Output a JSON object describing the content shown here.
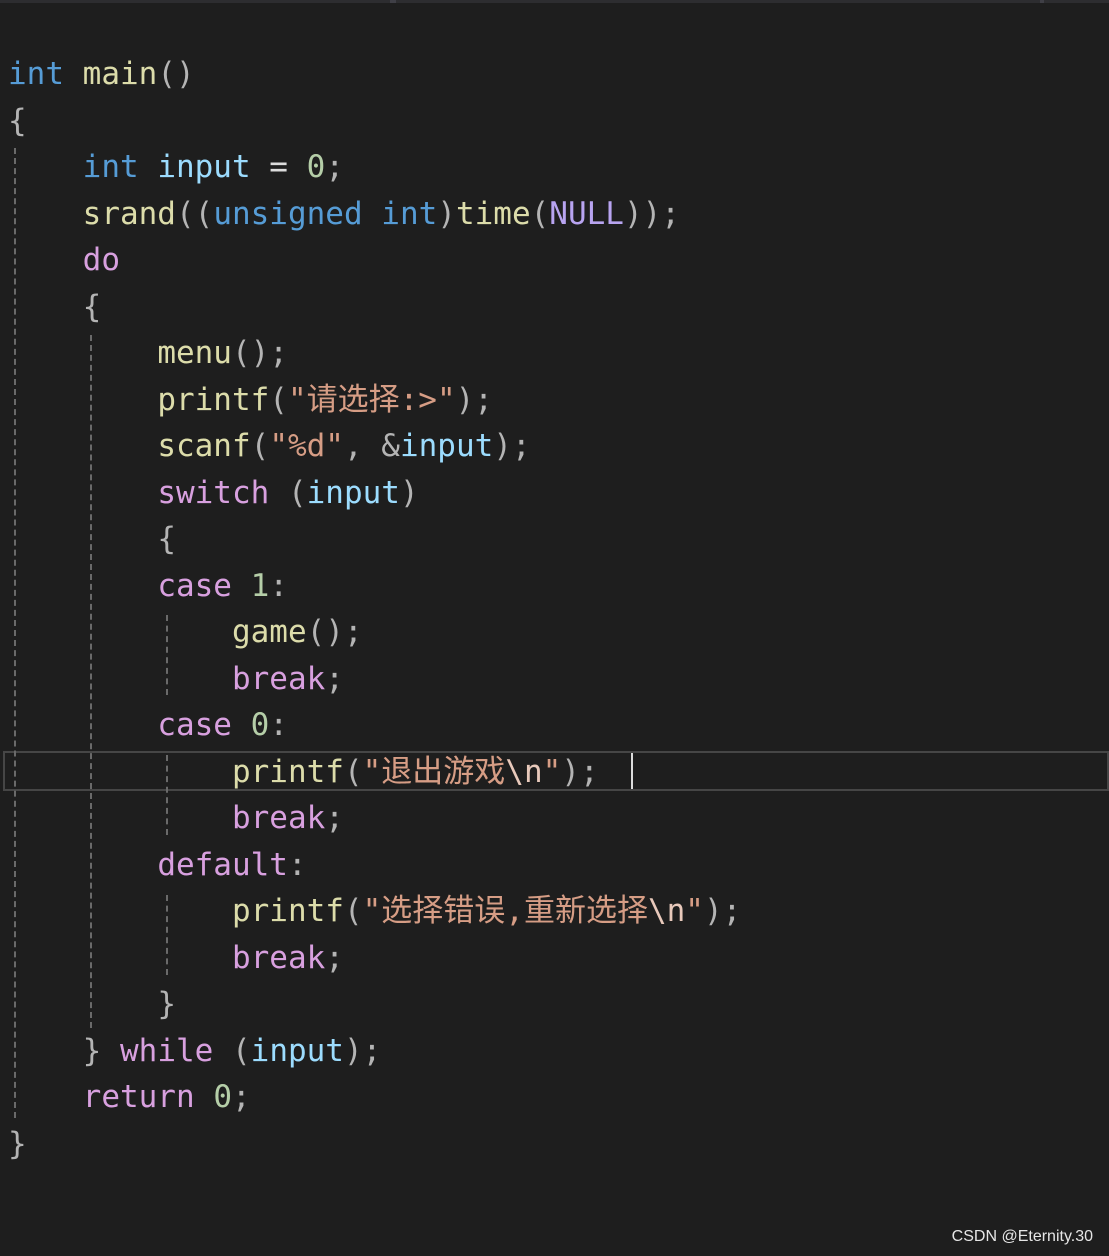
{
  "editor": {
    "lines": [
      [
        {
          "t": "int",
          "c": "kw"
        },
        {
          "t": " main",
          "c": "fn"
        },
        {
          "t": "()",
          "c": "punct"
        }
      ],
      [
        {
          "t": "{",
          "c": "punct"
        }
      ],
      [
        {
          "t": "    "
        },
        {
          "t": "int",
          "c": "kw"
        },
        {
          "t": " input",
          "c": "var"
        },
        {
          "t": " = ",
          "c": "plain"
        },
        {
          "t": "0",
          "c": "num"
        },
        {
          "t": ";",
          "c": "punct"
        }
      ],
      [
        {
          "t": "    "
        },
        {
          "t": "srand",
          "c": "fn"
        },
        {
          "t": "((",
          "c": "punct"
        },
        {
          "t": "unsigned",
          "c": "kw"
        },
        {
          "t": " "
        },
        {
          "t": "int",
          "c": "kw"
        },
        {
          "t": ")",
          "c": "punct"
        },
        {
          "t": "time",
          "c": "fn"
        },
        {
          "t": "(",
          "c": "punct"
        },
        {
          "t": "NULL",
          "c": "macro"
        },
        {
          "t": "));",
          "c": "punct"
        }
      ],
      [
        {
          "t": "    "
        },
        {
          "t": "do",
          "c": "ctrl"
        }
      ],
      [
        {
          "t": "    "
        },
        {
          "t": "{",
          "c": "punct"
        }
      ],
      [
        {
          "t": "        "
        },
        {
          "t": "menu",
          "c": "fn"
        },
        {
          "t": "();",
          "c": "punct"
        }
      ],
      [
        {
          "t": "        "
        },
        {
          "t": "printf",
          "c": "fn"
        },
        {
          "t": "(",
          "c": "punct"
        },
        {
          "t": "\"请选择:>\"",
          "c": "str"
        },
        {
          "t": ");",
          "c": "punct"
        }
      ],
      [
        {
          "t": "        "
        },
        {
          "t": "scanf",
          "c": "fn"
        },
        {
          "t": "(",
          "c": "punct"
        },
        {
          "t": "\"%d\"",
          "c": "str"
        },
        {
          "t": ", &",
          "c": "punct"
        },
        {
          "t": "input",
          "c": "var"
        },
        {
          "t": ");",
          "c": "punct"
        }
      ],
      [
        {
          "t": "        "
        },
        {
          "t": "switch",
          "c": "ctrl"
        },
        {
          "t": " (",
          "c": "punct"
        },
        {
          "t": "input",
          "c": "var"
        },
        {
          "t": ")",
          "c": "punct"
        }
      ],
      [
        {
          "t": "        "
        },
        {
          "t": "{",
          "c": "punct"
        }
      ],
      [
        {
          "t": "        "
        },
        {
          "t": "case",
          "c": "ctrl"
        },
        {
          "t": " "
        },
        {
          "t": "1",
          "c": "num"
        },
        {
          "t": ":",
          "c": "punct"
        }
      ],
      [
        {
          "t": "            "
        },
        {
          "t": "game",
          "c": "fn"
        },
        {
          "t": "();",
          "c": "punct"
        }
      ],
      [
        {
          "t": "            "
        },
        {
          "t": "break",
          "c": "ctrl"
        },
        {
          "t": ";",
          "c": "punct"
        }
      ],
      [
        {
          "t": "        "
        },
        {
          "t": "case",
          "c": "ctrl"
        },
        {
          "t": " "
        },
        {
          "t": "0",
          "c": "num"
        },
        {
          "t": ":",
          "c": "punct"
        }
      ],
      [
        {
          "t": "            "
        },
        {
          "t": "printf",
          "c": "fn"
        },
        {
          "t": "(",
          "c": "punct"
        },
        {
          "t": "\"退出游戏",
          "c": "str"
        },
        {
          "t": "\\n",
          "c": "esc"
        },
        {
          "t": "\"",
          "c": "str"
        },
        {
          "t": ");",
          "c": "punct"
        }
      ],
      [
        {
          "t": "            "
        },
        {
          "t": "break",
          "c": "ctrl"
        },
        {
          "t": ";",
          "c": "punct"
        }
      ],
      [
        {
          "t": "        "
        },
        {
          "t": "default",
          "c": "ctrl"
        },
        {
          "t": ":",
          "c": "punct"
        }
      ],
      [
        {
          "t": "            "
        },
        {
          "t": "printf",
          "c": "fn"
        },
        {
          "t": "(",
          "c": "punct"
        },
        {
          "t": "\"选择错误,重新选择",
          "c": "str"
        },
        {
          "t": "\\n",
          "c": "esc"
        },
        {
          "t": "\"",
          "c": "str"
        },
        {
          "t": ");",
          "c": "punct"
        }
      ],
      [
        {
          "t": "            "
        },
        {
          "t": "break",
          "c": "ctrl"
        },
        {
          "t": ";",
          "c": "punct"
        }
      ],
      [
        {
          "t": "        "
        },
        {
          "t": "}",
          "c": "punct"
        }
      ],
      [
        {
          "t": "    "
        },
        {
          "t": "}",
          "c": "punct"
        },
        {
          "t": " "
        },
        {
          "t": "while",
          "c": "ctrl"
        },
        {
          "t": " (",
          "c": "punct"
        },
        {
          "t": "input",
          "c": "var"
        },
        {
          "t": ");",
          "c": "punct"
        }
      ],
      [
        {
          "t": "    "
        },
        {
          "t": "return",
          "c": "ctrl"
        },
        {
          "t": " "
        },
        {
          "t": "0",
          "c": "num"
        },
        {
          "t": ";",
          "c": "punct"
        }
      ],
      [
        {
          "t": "}",
          "c": "punct"
        }
      ]
    ],
    "current_line_index": 15
  },
  "colors": {
    "background": "#1e1e1e",
    "keyword": "#569cd6",
    "control": "#d8a0df",
    "function": "#dcdcaa",
    "variable": "#9cdcfe",
    "number": "#b5cea8",
    "string": "#d69d85",
    "macro": "#b8a4f0"
  },
  "watermark": "CSDN @Eternity.30"
}
